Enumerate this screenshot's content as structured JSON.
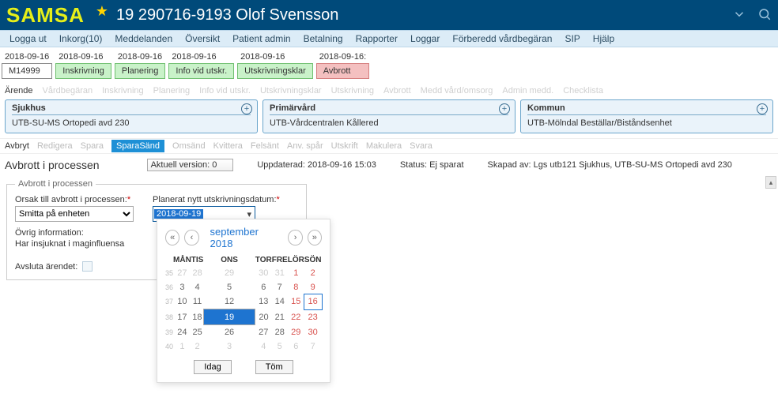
{
  "header": {
    "app": "SAMSA",
    "patient": "19 290716-9193 Olof Svensson"
  },
  "main_menu": [
    "Logga ut",
    "Inkorg(10)",
    "Meddelanden",
    "Översikt",
    "Patient admin",
    "Betalning",
    "Rapporter",
    "Loggar",
    "Förberedd vårdbegäran",
    "SIP",
    "Hjälp"
  ],
  "timeline": [
    {
      "date": "2018-09-16",
      "label": "M14999",
      "cls": "tl-white"
    },
    {
      "date": "2018-09-16",
      "label": "Inskrivning",
      "cls": "tl-green"
    },
    {
      "date": "2018-09-16",
      "label": "Planering",
      "cls": "tl-green"
    },
    {
      "date": "2018-09-16",
      "label": "Info vid utskr.",
      "cls": "tl-green"
    },
    {
      "date": "2018-09-16",
      "label": "Utskrivningsklar",
      "cls": "tl-green"
    },
    {
      "date": "2018-09-16:",
      "label": "Avbrott",
      "cls": "tl-pink"
    }
  ],
  "section_tabs": {
    "items": [
      "Ärende",
      "Vårdbegäran",
      "Inskrivning",
      "Planering",
      "Info vid utskr.",
      "Utskrivningsklar",
      "Utskrivning",
      "Avbrott",
      "Medd vård/omsorg",
      "Admin medd.",
      "Checklista"
    ],
    "active": "Ärende"
  },
  "actors": {
    "sjukhus": {
      "title": "Sjukhus",
      "value": "UTB-SU-MS Ortopedi avd 230"
    },
    "primarvard": {
      "title": "Primärvård",
      "value": "UTB-Vårdcentralen Kållered"
    },
    "kommun": {
      "title": "Kommun",
      "value": "UTB-Mölndal Beställar/Biståndsenhet"
    }
  },
  "action_bar": {
    "items": [
      {
        "label": "Avbryt",
        "state": "normal"
      },
      {
        "label": "Redigera",
        "state": "dis"
      },
      {
        "label": "Spara",
        "state": "dis"
      },
      {
        "label": "SparaSänd",
        "state": "primary"
      },
      {
        "label": "Omsänd",
        "state": "dis"
      },
      {
        "label": "Kvittera",
        "state": "dis"
      },
      {
        "label": "Felsänt",
        "state": "dis"
      },
      {
        "label": "Anv. spår",
        "state": "dis"
      },
      {
        "label": "Utskrift",
        "state": "dis"
      },
      {
        "label": "Makulera",
        "state": "dis"
      },
      {
        "label": "Svara",
        "state": "dis"
      }
    ]
  },
  "info_bar": {
    "title": "Avbrott i processen",
    "version_label": "Aktuell version: 0",
    "updated": "Uppdaterad: 2018-09-16 15:03",
    "status": "Status: Ej sparat",
    "created": "Skapad av: Lgs utb121 Sjukhus, UTB-SU-MS Ortopedi avd 230"
  },
  "form": {
    "legend": "Avbrott i processen",
    "orsak_label": "Orsak till avbrott i processen:",
    "orsak_value": "Smitta på enheten",
    "plan_label": "Planerat nytt utskrivningsdatum:",
    "plan_value": "2018-09-19",
    "ovrig_label": "Övrig information:",
    "ovrig_value": "Har insjuknat i maginfluensa",
    "avsluta_label": "Avsluta ärendet:"
  },
  "calendar": {
    "title": "september 2018",
    "dow": [
      "MÅN",
      "TIS",
      "ONS",
      "TOR",
      "FRE",
      "LÖR",
      "SÖN"
    ],
    "weeks": [
      {
        "wk": "35",
        "days": [
          {
            "d": "27",
            "cls": "out"
          },
          {
            "d": "28",
            "cls": "out"
          },
          {
            "d": "29",
            "cls": "out"
          },
          {
            "d": "30",
            "cls": "out"
          },
          {
            "d": "31",
            "cls": "out"
          },
          {
            "d": "1",
            "cls": "we"
          },
          {
            "d": "2",
            "cls": "we"
          }
        ]
      },
      {
        "wk": "36",
        "days": [
          {
            "d": "3"
          },
          {
            "d": "4"
          },
          {
            "d": "5"
          },
          {
            "d": "6"
          },
          {
            "d": "7"
          },
          {
            "d": "8",
            "cls": "we"
          },
          {
            "d": "9",
            "cls": "we"
          }
        ]
      },
      {
        "wk": "37",
        "days": [
          {
            "d": "10"
          },
          {
            "d": "11"
          },
          {
            "d": "12"
          },
          {
            "d": "13"
          },
          {
            "d": "14"
          },
          {
            "d": "15",
            "cls": "we"
          },
          {
            "d": "16",
            "cls": "we today"
          }
        ]
      },
      {
        "wk": "38",
        "days": [
          {
            "d": "17"
          },
          {
            "d": "18"
          },
          {
            "d": "19",
            "cls": "sel"
          },
          {
            "d": "20"
          },
          {
            "d": "21"
          },
          {
            "d": "22",
            "cls": "we"
          },
          {
            "d": "23",
            "cls": "we"
          }
        ]
      },
      {
        "wk": "39",
        "days": [
          {
            "d": "24"
          },
          {
            "d": "25"
          },
          {
            "d": "26"
          },
          {
            "d": "27"
          },
          {
            "d": "28"
          },
          {
            "d": "29",
            "cls": "we"
          },
          {
            "d": "30",
            "cls": "we"
          }
        ]
      },
      {
        "wk": "40",
        "days": [
          {
            "d": "1",
            "cls": "out"
          },
          {
            "d": "2",
            "cls": "out"
          },
          {
            "d": "3",
            "cls": "out"
          },
          {
            "d": "4",
            "cls": "out"
          },
          {
            "d": "5",
            "cls": "out"
          },
          {
            "d": "6",
            "cls": "out"
          },
          {
            "d": "7",
            "cls": "out"
          }
        ]
      }
    ],
    "btn_today": "Idag",
    "btn_clear": "Töm"
  }
}
